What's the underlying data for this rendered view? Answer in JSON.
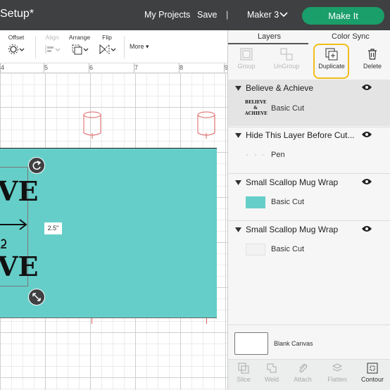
{
  "app": {
    "title": "Setup*"
  },
  "header": {
    "my_projects": "My Projects",
    "save": "Save",
    "separator": "|",
    "machine": "Maker 3",
    "make_it": "Make It"
  },
  "toolbar": {
    "offset": "Offset",
    "align": "Align",
    "arrange": "Arrange",
    "flip": "Flip",
    "more": "More"
  },
  "ruler": {
    "marks": [
      "4",
      "5",
      "6",
      "7",
      "8",
      "9"
    ]
  },
  "canvas": {
    "dimension_label": "2.5\"",
    "design_text_line1": "VE",
    "design_text_line2": "VE"
  },
  "panel": {
    "tabs": [
      "Layers",
      "Color Sync"
    ],
    "actions": {
      "group": "Group",
      "ungroup": "UnGroup",
      "duplicate": "Duplicate",
      "delete": "Delete"
    },
    "layers": [
      {
        "name": "Believe & Achieve",
        "operation": "Basic Cut",
        "thumb_text": "BELIEVE & ACHIEVE",
        "highlight": true
      },
      {
        "name": "Hide This Layer Before Cut...",
        "operation": "Pen",
        "highlight": false
      },
      {
        "name": "Small Scallop Mug Wrap",
        "operation": "Basic Cut",
        "swatch": "#66cec9",
        "highlight": false
      },
      {
        "name": "Small Scallop Mug Wrap",
        "operation": "Basic Cut",
        "swatch": "#f2f2f2",
        "highlight": false
      }
    ],
    "blank_canvas": "Blank Canvas",
    "bottom_tools": {
      "slice": "Slice",
      "weld": "Weld",
      "attach": "Attach",
      "flatten": "Flatten",
      "contour": "Contour"
    }
  },
  "colors": {
    "header_bg": "#3f4042",
    "make_it_green": "#1a9e6a",
    "mug_teal": "#66cec9",
    "duplicate_highlight": "#f2bd1a"
  }
}
